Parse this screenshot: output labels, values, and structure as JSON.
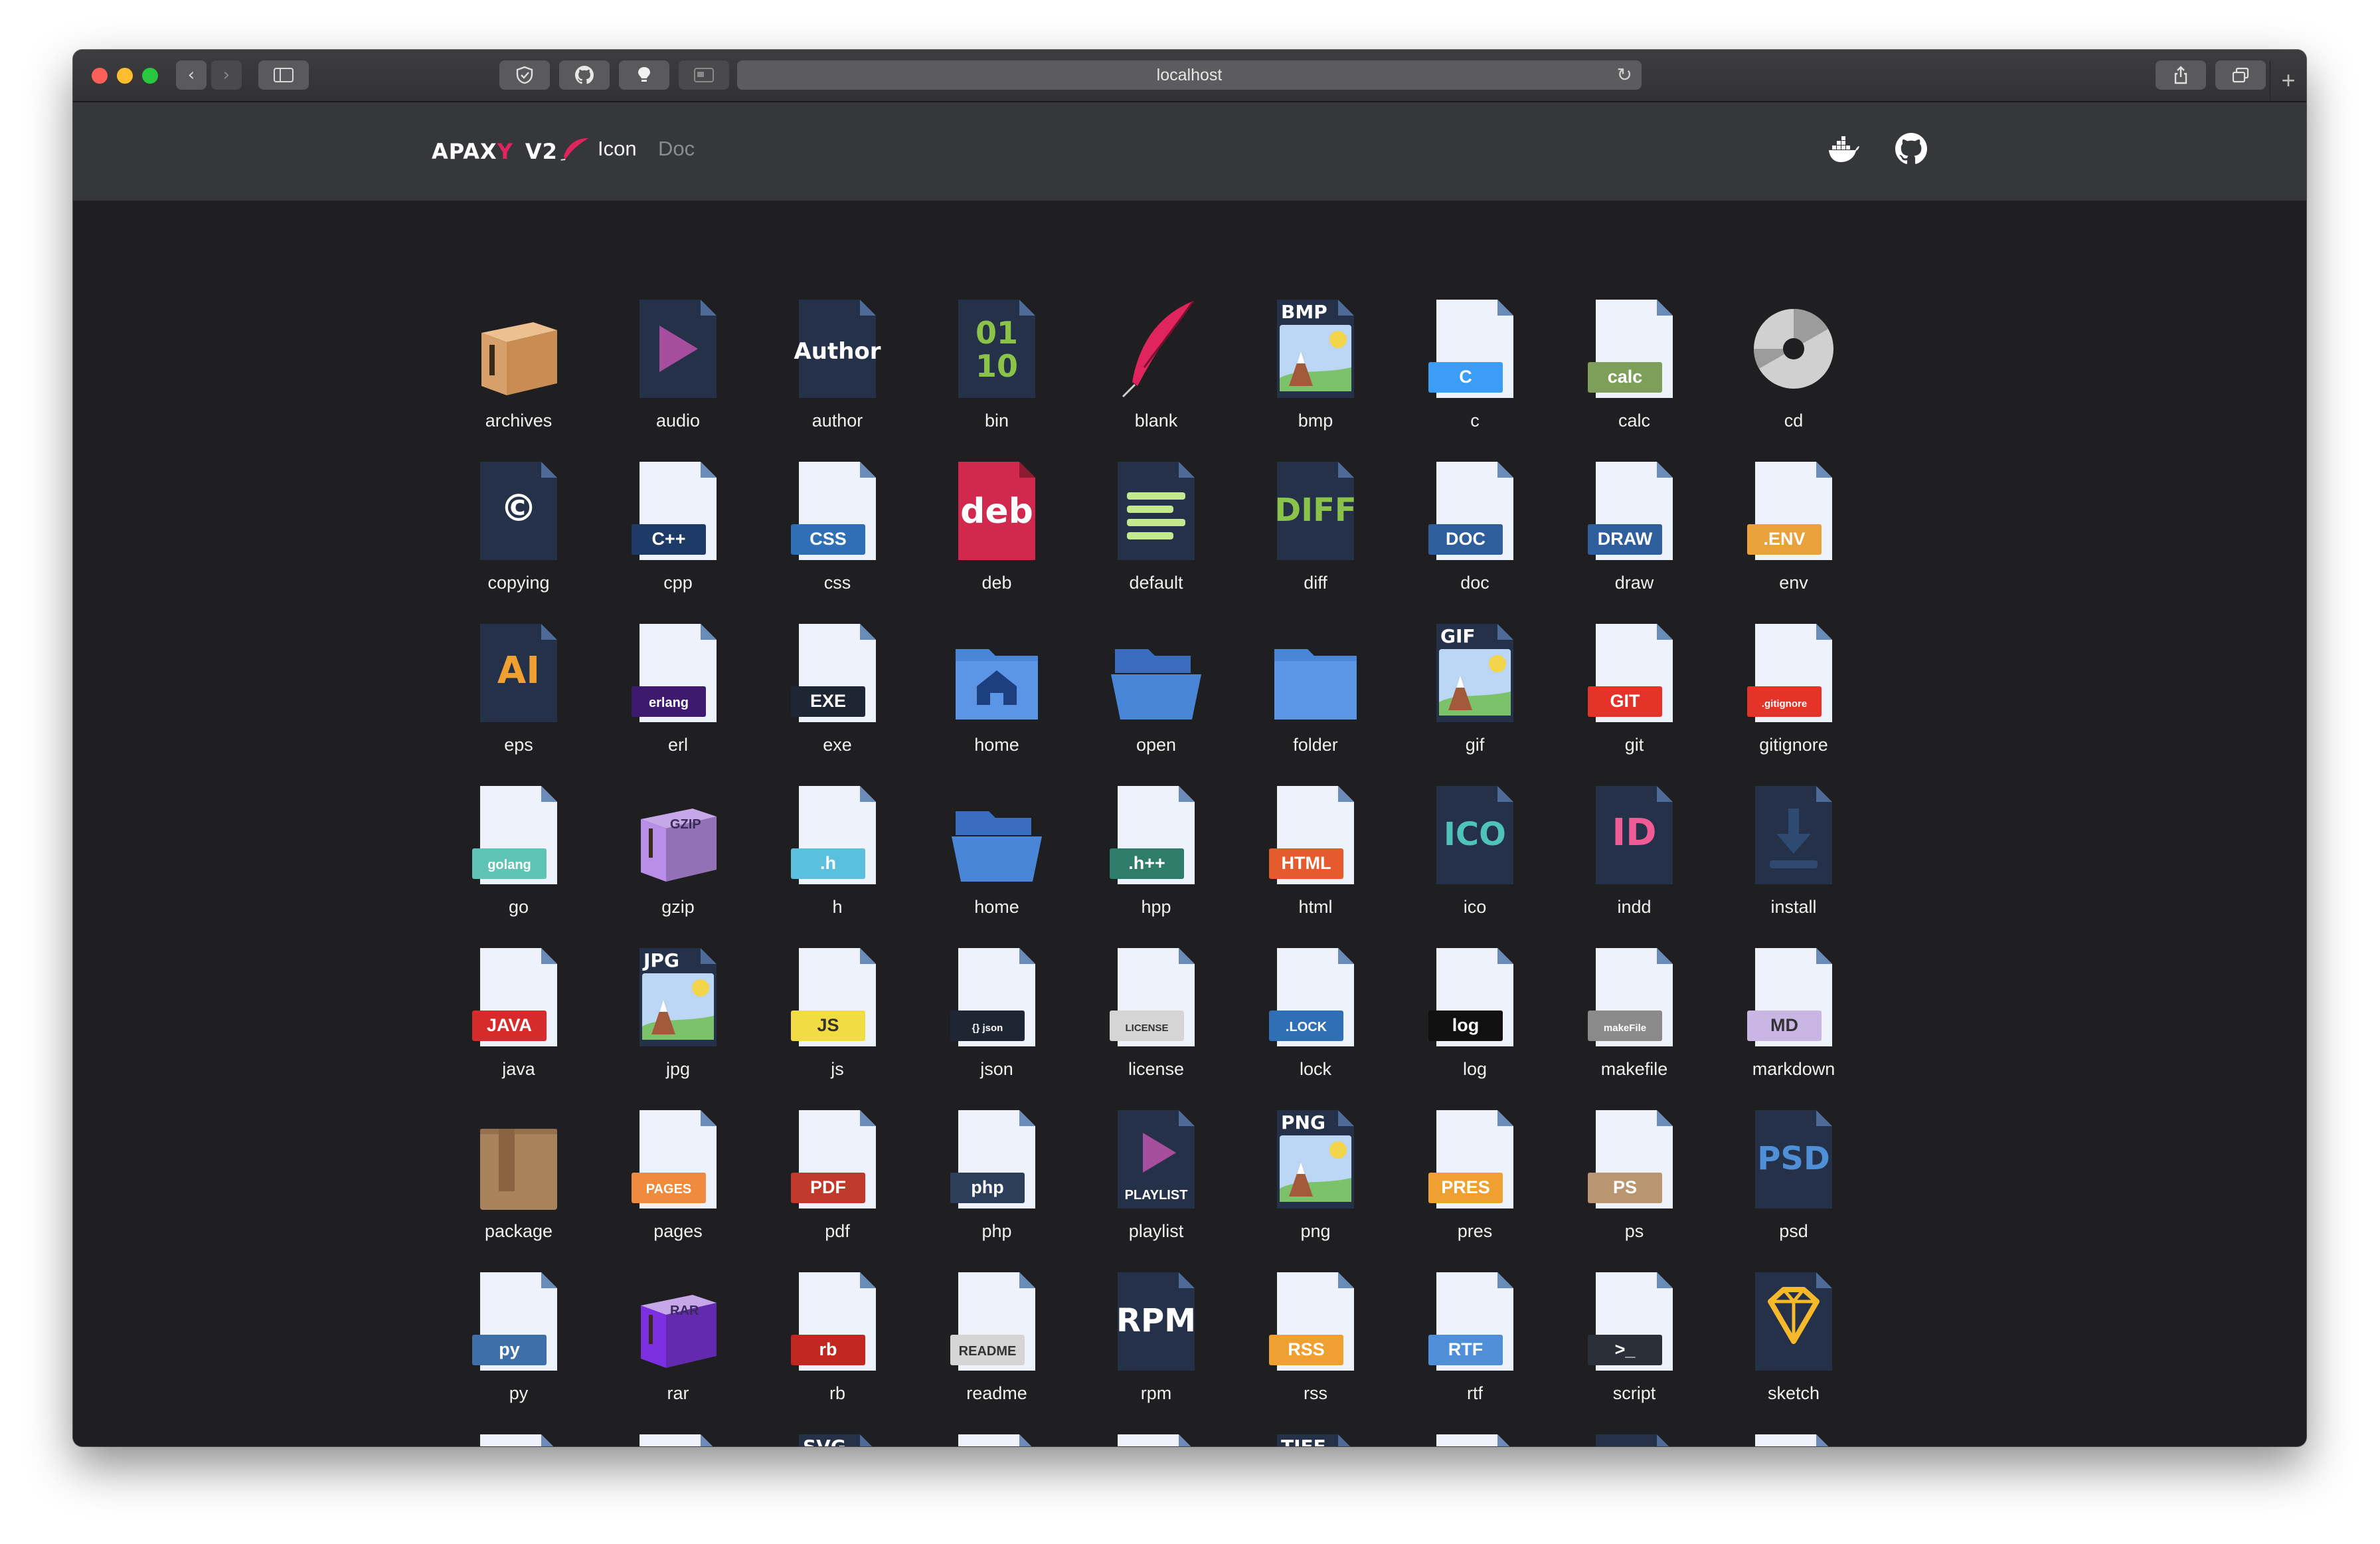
{
  "browser": {
    "url": "localhost",
    "nav_back_icon": "chevron-left-icon",
    "nav_forward_icon": "chevron-right-icon"
  },
  "header": {
    "brand_prefix": "APAX",
    "brand_highlight": "Y",
    "brand_suffix": "V2",
    "nav": [
      {
        "label": "Icon",
        "active": true
      },
      {
        "label": "Doc",
        "active": false
      }
    ],
    "right_icons": [
      "docker-icon",
      "github-icon"
    ]
  },
  "icons": [
    {
      "label": "archives",
      "type": "box",
      "color": "#d7a06a"
    },
    {
      "label": "audio",
      "type": "dark-play",
      "color": "#a64d9e"
    },
    {
      "label": "author",
      "type": "dark-text",
      "text": "Author",
      "color": "#ffffff"
    },
    {
      "label": "bin",
      "type": "dark-text",
      "text": "01\n10",
      "color": "#8bc34a"
    },
    {
      "label": "blank",
      "type": "feather",
      "color": "#e0245e"
    },
    {
      "label": "bmp",
      "type": "image",
      "text": "BMP"
    },
    {
      "label": "c",
      "type": "light-badge",
      "text": "C",
      "color": "#3b9df5"
    },
    {
      "label": "calc",
      "type": "light-badge",
      "text": "calc",
      "color": "#7e9f5a"
    },
    {
      "label": "cd",
      "type": "disc",
      "color": "#d0d0d0"
    },
    {
      "label": "copying",
      "type": "dark-text",
      "text": "©",
      "color": "#ffffff"
    },
    {
      "label": "cpp",
      "type": "light-badge",
      "text": "C++",
      "color": "#1e3a66"
    },
    {
      "label": "css",
      "type": "light-badge",
      "text": "CSS",
      "color": "#2f6fb5"
    },
    {
      "label": "deb",
      "type": "solid-text",
      "text": "deb",
      "color": "#d1294e"
    },
    {
      "label": "default",
      "type": "dark-lines",
      "color": "#c3e88d"
    },
    {
      "label": "diff",
      "type": "dark-text",
      "text": "DIFF",
      "color": "#8bc34a"
    },
    {
      "label": "doc",
      "type": "light-badge",
      "text": "DOC",
      "color": "#2f5e9c"
    },
    {
      "label": "draw",
      "type": "light-badge",
      "text": "DRAW",
      "color": "#2f5e9c"
    },
    {
      "label": "env",
      "type": "light-badge",
      "text": ".ENV",
      "color": "#e9a23b"
    },
    {
      "label": "eps",
      "type": "dark-text",
      "text": "AI",
      "color": "#f0a030"
    },
    {
      "label": "erl",
      "type": "light-badge",
      "text": "erlang",
      "color": "#3e1a6e"
    },
    {
      "label": "exe",
      "type": "light-badge",
      "text": "EXE",
      "color": "#1e2633"
    },
    {
      "label": "home",
      "type": "folder-home",
      "color": "#4a86d8"
    },
    {
      "label": "open",
      "type": "folder-open",
      "color": "#4a86d8"
    },
    {
      "label": "folder",
      "type": "folder",
      "color": "#4a86d8"
    },
    {
      "label": "gif",
      "type": "image",
      "text": "GIF"
    },
    {
      "label": "git",
      "type": "light-badge",
      "text": "GIT",
      "color": "#e5332a"
    },
    {
      "label": "gitignore",
      "type": "light-badge",
      "text": ".gitignore",
      "color": "#e5332a"
    },
    {
      "label": "go",
      "type": "light-badge",
      "text": "golang",
      "color": "#5ec4b6"
    },
    {
      "label": "gzip",
      "type": "box-purple",
      "text": "GZIP",
      "color": "#b98ee8"
    },
    {
      "label": "h",
      "type": "light-badge",
      "text": ".h",
      "color": "#5bc0de"
    },
    {
      "label": "home",
      "type": "folder-open",
      "color": "#4a86d8"
    },
    {
      "label": "hpp",
      "type": "light-badge",
      "text": ".h++",
      "color": "#2e7d6b"
    },
    {
      "label": "html",
      "type": "light-badge",
      "text": "HTML",
      "color": "#e55b2d"
    },
    {
      "label": "ico",
      "type": "dark-text",
      "text": "ICO",
      "color": "#4fc3b9"
    },
    {
      "label": "indd",
      "type": "dark-text",
      "text": "ID",
      "color": "#ef5c95"
    },
    {
      "label": "install",
      "type": "dark-download",
      "color": "#2e4a70"
    },
    {
      "label": "java",
      "type": "light-badge",
      "text": "JAVA",
      "color": "#d62b2b"
    },
    {
      "label": "jpg",
      "type": "image",
      "text": "JPG"
    },
    {
      "label": "js",
      "type": "light-badge",
      "text": "JS",
      "color": "#f2dc44"
    },
    {
      "label": "json",
      "type": "light-badge",
      "text": "{} json",
      "color": "#1e2633"
    },
    {
      "label": "license",
      "type": "light-badge",
      "text": "LICENSE",
      "color": "#d5d5d5"
    },
    {
      "label": "lock",
      "type": "light-badge",
      "text": ".LOCK",
      "color": "#2f6fb5"
    },
    {
      "label": "log",
      "type": "light-badge",
      "text": "log",
      "color": "#111111"
    },
    {
      "label": "makefile",
      "type": "light-badge",
      "text": "makeFile",
      "color": "#8a8a8a"
    },
    {
      "label": "markdown",
      "type": "light-badge",
      "text": "MD",
      "color": "#c9b6e4"
    },
    {
      "label": "package",
      "type": "package",
      "color": "#a8825a"
    },
    {
      "label": "pages",
      "type": "light-badge",
      "text": "PAGES",
      "color": "#f08a3c"
    },
    {
      "label": "pdf",
      "type": "light-badge",
      "text": "PDF",
      "color": "#c0392b"
    },
    {
      "label": "php",
      "type": "light-badge",
      "text": "php",
      "color": "#2c3e5a"
    },
    {
      "label": "playlist",
      "type": "dark-playlist",
      "text": "PLAYLIST",
      "color": "#a64d9e"
    },
    {
      "label": "png",
      "type": "image",
      "text": "PNG"
    },
    {
      "label": "pres",
      "type": "light-badge",
      "text": "PRES",
      "color": "#f0a030"
    },
    {
      "label": "ps",
      "type": "light-badge",
      "text": "PS",
      "color": "#b99670"
    },
    {
      "label": "psd",
      "type": "dark-text",
      "text": "PSD",
      "color": "#4f8fd8"
    },
    {
      "label": "py",
      "type": "light-badge",
      "text": "py",
      "color": "#3f6fa8"
    },
    {
      "label": "rar",
      "type": "box-purple",
      "text": "RAR",
      "color": "#7b2fe0"
    },
    {
      "label": "rb",
      "type": "light-badge",
      "text": "rb",
      "color": "#c1271f"
    },
    {
      "label": "readme",
      "type": "light-badge",
      "text": "README",
      "color": "#d5d5d5"
    },
    {
      "label": "rpm",
      "type": "dark-text",
      "text": "RPM",
      "color": "#ffffff"
    },
    {
      "label": "rss",
      "type": "light-badge",
      "text": "RSS",
      "color": "#f0a030"
    },
    {
      "label": "rtf",
      "type": "light-badge",
      "text": "RTF",
      "color": "#4f8fd8"
    },
    {
      "label": "script",
      "type": "light-badge",
      "text": ">_",
      "color": "#2b2f38"
    },
    {
      "label": "sketch",
      "type": "dark-gem",
      "color": "#f6b92b"
    },
    {
      "label": "",
      "type": "light-plain"
    },
    {
      "label": "",
      "type": "light-plain"
    },
    {
      "label": "",
      "type": "image",
      "text": "SVG"
    },
    {
      "label": "",
      "type": "light-plain"
    },
    {
      "label": "",
      "type": "light-plain"
    },
    {
      "label": "",
      "type": "image",
      "text": "TIFF"
    },
    {
      "label": "",
      "type": "light-plain"
    },
    {
      "label": "",
      "type": "dark-text",
      "text": "?",
      "color": "#ffffff"
    },
    {
      "label": "",
      "type": "light-plain"
    }
  ]
}
